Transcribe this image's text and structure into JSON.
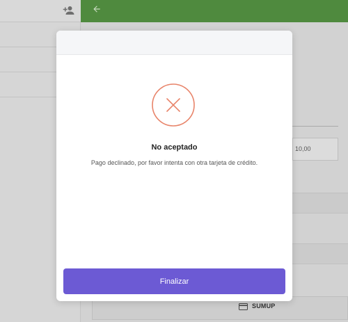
{
  "background": {
    "amount_value": "10,00",
    "payment_method_label": "SUMUP"
  },
  "icons": {
    "add_user": "add-user-icon",
    "back": "arrow-back-icon",
    "status": "close-icon",
    "card": "credit-card-icon"
  },
  "modal": {
    "title": "No aceptado",
    "message": "Pago declinado, por favor intenta con otra tarjeta de crédito.",
    "finish_label": "Finalizar"
  },
  "colors": {
    "header_green": "#4f8a3e",
    "error_accent": "#e8846a",
    "primary_button": "#6c5ad4"
  }
}
